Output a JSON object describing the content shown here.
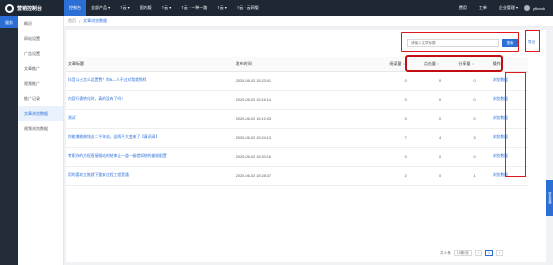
{
  "brand": {
    "name": "营销控制台"
  },
  "topnav": {
    "items": [
      "控制台",
      "全部产品 ▾",
      "T云 ▾",
      "国内版",
      "T云 ▾",
      "T云 · 一种一路",
      "T云 ▾",
      "T云 · 云网版"
    ],
    "active_index": 0,
    "right": [
      "费用",
      "工单",
      "企业管理 ▾"
    ],
    "user": "yflcxxk"
  },
  "rail": {
    "label": "服务"
  },
  "sidebar": {
    "items": [
      "概况",
      "网站设置",
      "广告设置",
      "文章推广",
      "视频推广",
      "推广记录",
      "文章浏览数据",
      "视频浏览数据"
    ],
    "active_index": 6
  },
  "breadcrumb": {
    "home": "首页",
    "current": "文章浏览数据"
  },
  "search": {
    "placeholder": "请输入文章标题",
    "button": "搜索"
  },
  "export": {
    "label": "导出"
  },
  "table": {
    "headers": {
      "title": "文章标题",
      "time": "发布时间",
      "reads": "阅读量",
      "clicks": "点击量",
      "shares": "分享量",
      "op": "操作"
    },
    "rows": [
      {
        "title": "抖音斗士怎么设置费？你B—人不过对我就那样",
        "time": "2020-06-02 15:23:01",
        "reads": "0",
        "clicks": "0",
        "shares": "0",
        "op": "浏览数据"
      },
      {
        "title": "内容行需转化时，真的没有了吗?",
        "time": "2020-06-02 15:16:14",
        "reads": "0",
        "clicks": "0",
        "shares": "0",
        "op": "浏览数据"
      },
      {
        "title": "测试",
        "time": "2020-06-02 15:12:43",
        "reads": "0",
        "clicks": "0",
        "shares": "0",
        "op": "浏览数据"
      },
      {
        "title": "你能增能做钱去二千年站，这两千大变来了【真讯网】",
        "time": "2020-06-02 15:24:13",
        "reads": "7",
        "clicks": "4",
        "shares": "3",
        "op": "浏览数据"
      },
      {
        "title": "考职办的方权直接服站的结束让一道一级就如想的量收配置",
        "time": "2020-06-02 15:20:16",
        "reads": "0",
        "clicks": "0",
        "shares": "0",
        "op": "浏览数据"
      },
      {
        "title": "用的喜欢立推就下整安过程工程是通",
        "time": "2020-06-02 15:28:37",
        "reads": "2",
        "clicks": "0",
        "shares": "1",
        "op": "浏览数据"
      }
    ]
  },
  "pager": {
    "total": "共 6 条",
    "size": "10条/页",
    "prev": "‹",
    "page": "1",
    "next": "›"
  },
  "float_tab": {
    "label": "联系客服"
  }
}
